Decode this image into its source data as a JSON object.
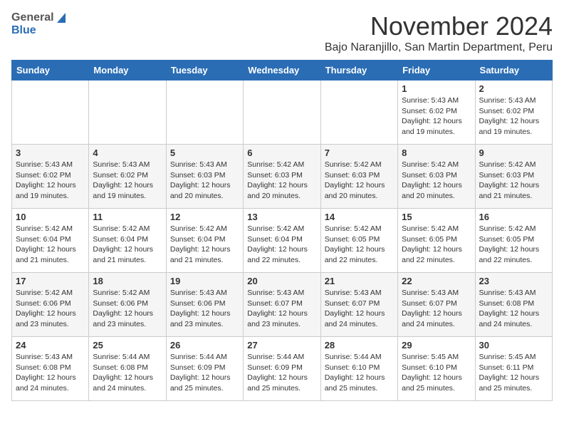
{
  "header": {
    "logo_general": "General",
    "logo_blue": "Blue",
    "month_title": "November 2024",
    "subtitle": "Bajo Naranjillo, San Martin Department, Peru"
  },
  "days_of_week": [
    "Sunday",
    "Monday",
    "Tuesday",
    "Wednesday",
    "Thursday",
    "Friday",
    "Saturday"
  ],
  "weeks": [
    [
      {
        "day": "",
        "info": ""
      },
      {
        "day": "",
        "info": ""
      },
      {
        "day": "",
        "info": ""
      },
      {
        "day": "",
        "info": ""
      },
      {
        "day": "",
        "info": ""
      },
      {
        "day": "1",
        "info": "Sunrise: 5:43 AM\nSunset: 6:02 PM\nDaylight: 12 hours and 19 minutes."
      },
      {
        "day": "2",
        "info": "Sunrise: 5:43 AM\nSunset: 6:02 PM\nDaylight: 12 hours and 19 minutes."
      }
    ],
    [
      {
        "day": "3",
        "info": "Sunrise: 5:43 AM\nSunset: 6:02 PM\nDaylight: 12 hours and 19 minutes."
      },
      {
        "day": "4",
        "info": "Sunrise: 5:43 AM\nSunset: 6:02 PM\nDaylight: 12 hours and 19 minutes."
      },
      {
        "day": "5",
        "info": "Sunrise: 5:43 AM\nSunset: 6:03 PM\nDaylight: 12 hours and 20 minutes."
      },
      {
        "day": "6",
        "info": "Sunrise: 5:42 AM\nSunset: 6:03 PM\nDaylight: 12 hours and 20 minutes."
      },
      {
        "day": "7",
        "info": "Sunrise: 5:42 AM\nSunset: 6:03 PM\nDaylight: 12 hours and 20 minutes."
      },
      {
        "day": "8",
        "info": "Sunrise: 5:42 AM\nSunset: 6:03 PM\nDaylight: 12 hours and 20 minutes."
      },
      {
        "day": "9",
        "info": "Sunrise: 5:42 AM\nSunset: 6:03 PM\nDaylight: 12 hours and 21 minutes."
      }
    ],
    [
      {
        "day": "10",
        "info": "Sunrise: 5:42 AM\nSunset: 6:04 PM\nDaylight: 12 hours and 21 minutes."
      },
      {
        "day": "11",
        "info": "Sunrise: 5:42 AM\nSunset: 6:04 PM\nDaylight: 12 hours and 21 minutes."
      },
      {
        "day": "12",
        "info": "Sunrise: 5:42 AM\nSunset: 6:04 PM\nDaylight: 12 hours and 21 minutes."
      },
      {
        "day": "13",
        "info": "Sunrise: 5:42 AM\nSunset: 6:04 PM\nDaylight: 12 hours and 22 minutes."
      },
      {
        "day": "14",
        "info": "Sunrise: 5:42 AM\nSunset: 6:05 PM\nDaylight: 12 hours and 22 minutes."
      },
      {
        "day": "15",
        "info": "Sunrise: 5:42 AM\nSunset: 6:05 PM\nDaylight: 12 hours and 22 minutes."
      },
      {
        "day": "16",
        "info": "Sunrise: 5:42 AM\nSunset: 6:05 PM\nDaylight: 12 hours and 22 minutes."
      }
    ],
    [
      {
        "day": "17",
        "info": "Sunrise: 5:42 AM\nSunset: 6:06 PM\nDaylight: 12 hours and 23 minutes."
      },
      {
        "day": "18",
        "info": "Sunrise: 5:42 AM\nSunset: 6:06 PM\nDaylight: 12 hours and 23 minutes."
      },
      {
        "day": "19",
        "info": "Sunrise: 5:43 AM\nSunset: 6:06 PM\nDaylight: 12 hours and 23 minutes."
      },
      {
        "day": "20",
        "info": "Sunrise: 5:43 AM\nSunset: 6:07 PM\nDaylight: 12 hours and 23 minutes."
      },
      {
        "day": "21",
        "info": "Sunrise: 5:43 AM\nSunset: 6:07 PM\nDaylight: 12 hours and 24 minutes."
      },
      {
        "day": "22",
        "info": "Sunrise: 5:43 AM\nSunset: 6:07 PM\nDaylight: 12 hours and 24 minutes."
      },
      {
        "day": "23",
        "info": "Sunrise: 5:43 AM\nSunset: 6:08 PM\nDaylight: 12 hours and 24 minutes."
      }
    ],
    [
      {
        "day": "24",
        "info": "Sunrise: 5:43 AM\nSunset: 6:08 PM\nDaylight: 12 hours and 24 minutes."
      },
      {
        "day": "25",
        "info": "Sunrise: 5:44 AM\nSunset: 6:08 PM\nDaylight: 12 hours and 24 minutes."
      },
      {
        "day": "26",
        "info": "Sunrise: 5:44 AM\nSunset: 6:09 PM\nDaylight: 12 hours and 25 minutes."
      },
      {
        "day": "27",
        "info": "Sunrise: 5:44 AM\nSunset: 6:09 PM\nDaylight: 12 hours and 25 minutes."
      },
      {
        "day": "28",
        "info": "Sunrise: 5:44 AM\nSunset: 6:10 PM\nDaylight: 12 hours and 25 minutes."
      },
      {
        "day": "29",
        "info": "Sunrise: 5:45 AM\nSunset: 6:10 PM\nDaylight: 12 hours and 25 minutes."
      },
      {
        "day": "30",
        "info": "Sunrise: 5:45 AM\nSunset: 6:11 PM\nDaylight: 12 hours and 25 minutes."
      }
    ]
  ]
}
